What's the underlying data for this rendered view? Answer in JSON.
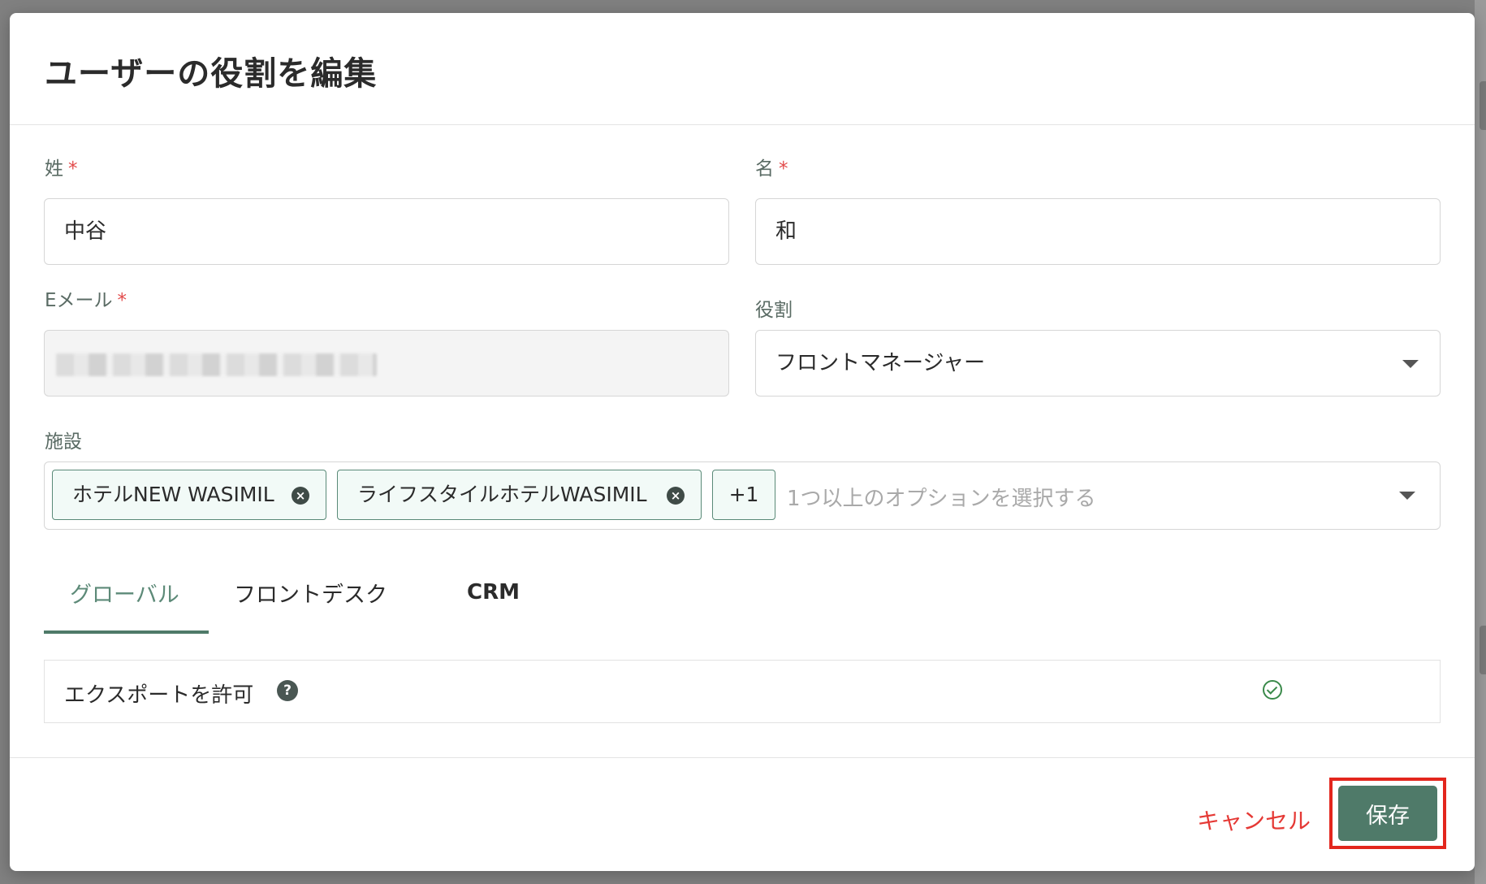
{
  "dialog": {
    "title": "ユーザーの役割を編集"
  },
  "form": {
    "last_name": {
      "label": "姓",
      "required": "*",
      "value": "中谷"
    },
    "first_name": {
      "label": "名",
      "required": "*",
      "value": "和"
    },
    "email": {
      "label": "Eメール",
      "required": "*",
      "value": ""
    },
    "role": {
      "label": "役割",
      "value": "フロントマネージャー"
    },
    "facilities": {
      "label": "施設",
      "chips": [
        "ホテルNEW WASIMIL",
        "ライフスタイルホテルWASIMIL"
      ],
      "more": "+1",
      "placeholder": "1つ以上のオプションを選択する"
    }
  },
  "tabs": [
    {
      "label": "グローバル",
      "active": true
    },
    {
      "label": "フロントデスク",
      "active": false
    },
    {
      "label": "CRM",
      "active": false
    }
  ],
  "permissions": [
    {
      "label": "エクスポートを許可",
      "help": "?",
      "enabled": true
    }
  ],
  "footer": {
    "cancel_label": "キャンセル",
    "save_label": "保存"
  },
  "colors": {
    "accent": "#4f7a69",
    "danger": "#e53935",
    "highlight": "#e3261d",
    "check": "#3a8a4a"
  }
}
